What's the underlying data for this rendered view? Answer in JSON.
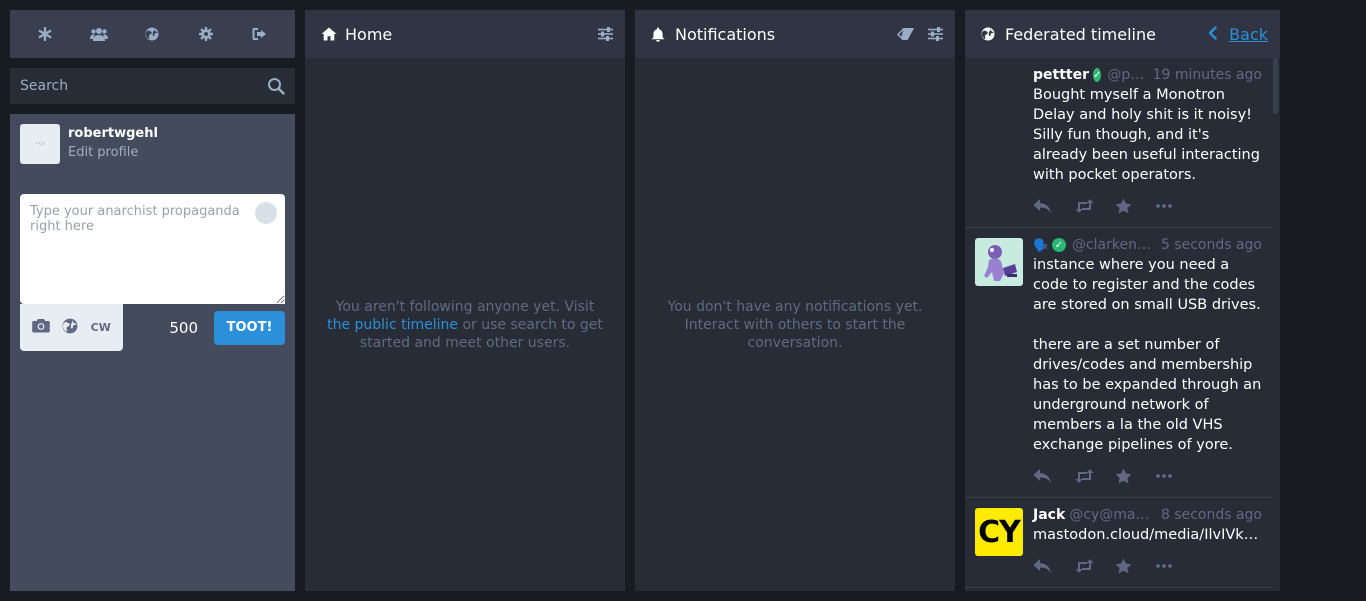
{
  "drawer": {
    "nav": [
      {
        "icon": "asterisk-icon"
      },
      {
        "icon": "users-icon"
      },
      {
        "icon": "globe-icon"
      },
      {
        "icon": "gear-icon"
      },
      {
        "icon": "sign-out-icon"
      }
    ],
    "search_placeholder": "Search",
    "profile": {
      "username": "robertwgehl",
      "edit_label": "Edit profile"
    },
    "compose": {
      "placeholder": "Type your anarchist propaganda right here",
      "cw_label": "CW",
      "char_count": "500",
      "toot_label": "TOOT!"
    }
  },
  "columns": {
    "home": {
      "title": "Home",
      "empty_prefix": "You aren't following anyone yet. Visit ",
      "empty_link": "the public timeline",
      "empty_suffix": " or use search to get started and meet other users."
    },
    "notifications": {
      "title": "Notifications",
      "empty": "You don't have any notifications yet. Interact with others to start the conversation."
    },
    "federated": {
      "title": "Federated timeline",
      "back_label": "Back",
      "statuses": [
        {
          "display_name": "pettter",
          "verified": true,
          "acct": "@pettter@mastodon.social",
          "time": "19 minutes ago",
          "content": "Bought myself a Monotron Delay and holy shit is it noisy! Silly fun though, and it's already been useful interacting with pocket operators."
        },
        {
          "display_name": "🗣️",
          "verified": true,
          "acct": "@clarkencielle",
          "time": "5 seconds ago",
          "content": "instance where you need a code to register and the codes are stored on small USB drives.\n\nthere are a set number of drives/codes and membership has to be expanded through an underground network of members a la the old VHS exchange pipelines of yore."
        },
        {
          "display_name": "Jack",
          "verified": false,
          "acct": "@cy@mastodon.cloud",
          "time": "8 seconds ago",
          "avatar_text": "CY",
          "content": "mastodon.cloud/media/IlvIVk-TI..."
        }
      ]
    }
  },
  "colors": {
    "accent": "#2b90d9",
    "background": "#191b22",
    "column": "#282c37",
    "header": "#313543",
    "verified": "#2bb673"
  }
}
